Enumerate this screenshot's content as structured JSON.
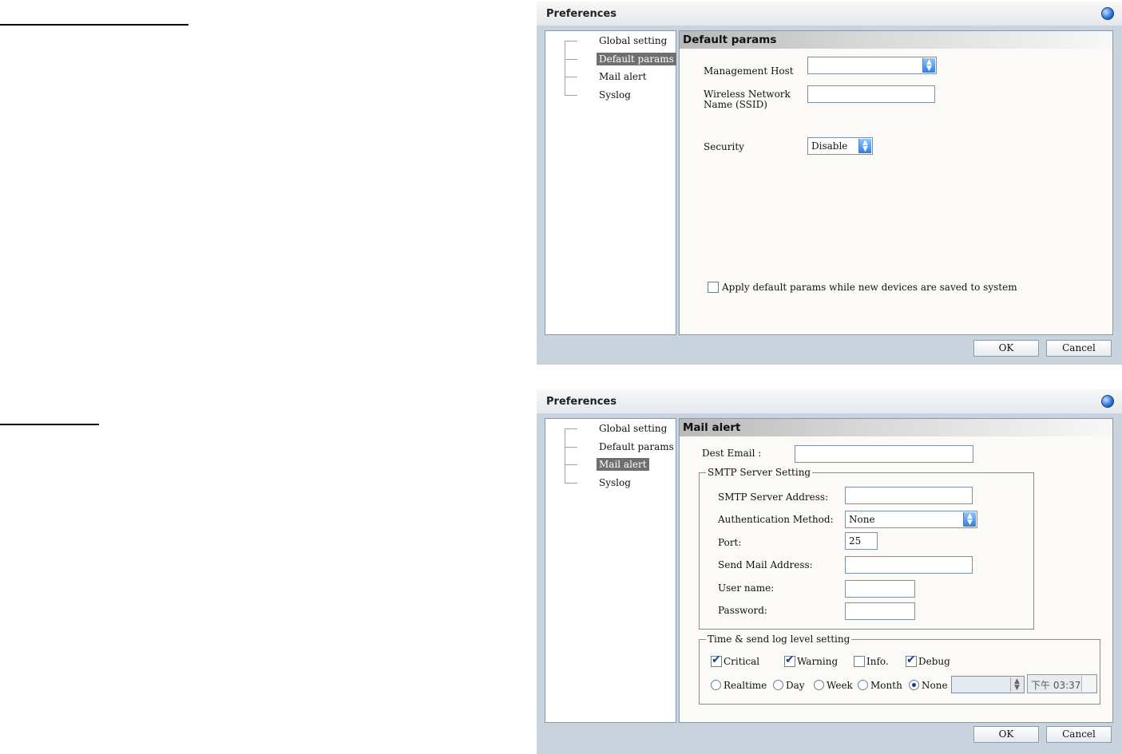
{
  "window1": {
    "title": "Preferences",
    "tree": [
      "Global setting",
      "Default params",
      "Mail alert",
      "Syslog"
    ],
    "selected_index": 1,
    "panel_title": "Default params",
    "fields": {
      "management_host_label": "Management Host",
      "management_host_value": "",
      "ssid_label_line1": "Wireless Network",
      "ssid_label_line2": "Name (SSID)",
      "ssid_value": "",
      "security_label": "Security",
      "security_value": "Disable"
    },
    "apply_checkbox_label": "Apply default params while new devices are saved to system",
    "apply_checked": false,
    "ok_label": "OK",
    "cancel_label": "Cancel"
  },
  "window2": {
    "title": "Preferences",
    "tree": [
      "Global setting",
      "Default params",
      "Mail alert",
      "Syslog"
    ],
    "selected_index": 2,
    "panel_title": "Mail alert",
    "dest_email_label": "Dest Email :",
    "dest_email_value": "",
    "smtp": {
      "group_label": "SMTP Server Setting",
      "server_address_label": "SMTP Server Address:",
      "server_address_value": "",
      "auth_method_label": "Authentication Method:",
      "auth_method_value": "None",
      "port_label": "Port:",
      "port_value": "25",
      "send_mail_label": "Send Mail Address:",
      "send_mail_value": "",
      "username_label": "User name:",
      "username_value": "",
      "password_label": "Password:",
      "password_value": ""
    },
    "log": {
      "group_label": "Time & send log level setting",
      "levels": [
        {
          "label": "Critical",
          "checked": true
        },
        {
          "label": "Warning",
          "checked": true
        },
        {
          "label": "Info.",
          "checked": false
        },
        {
          "label": "Debug",
          "checked": true
        }
      ],
      "frequency": [
        {
          "label": "Realtime",
          "selected": false
        },
        {
          "label": "Day",
          "selected": false
        },
        {
          "label": "Week",
          "selected": false
        },
        {
          "label": "Month",
          "selected": false
        },
        {
          "label": "None",
          "selected": true
        }
      ],
      "day_select_value": "",
      "time_value": "下午 03:37:"
    },
    "ok_label": "OK",
    "cancel_label": "Cancel"
  }
}
